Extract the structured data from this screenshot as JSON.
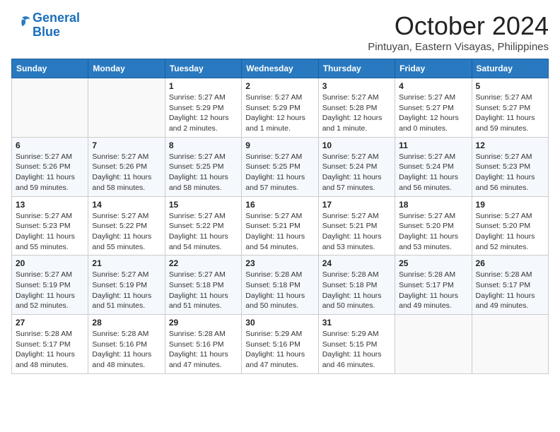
{
  "logo": {
    "line1": "General",
    "line2": "Blue"
  },
  "title": "October 2024",
  "location": "Pintuyan, Eastern Visayas, Philippines",
  "weekdays": [
    "Sunday",
    "Monday",
    "Tuesday",
    "Wednesday",
    "Thursday",
    "Friday",
    "Saturday"
  ],
  "weeks": [
    [
      {
        "day": "",
        "info": ""
      },
      {
        "day": "",
        "info": ""
      },
      {
        "day": "1",
        "info": "Sunrise: 5:27 AM\nSunset: 5:29 PM\nDaylight: 12 hours and 2 minutes."
      },
      {
        "day": "2",
        "info": "Sunrise: 5:27 AM\nSunset: 5:29 PM\nDaylight: 12 hours and 1 minute."
      },
      {
        "day": "3",
        "info": "Sunrise: 5:27 AM\nSunset: 5:28 PM\nDaylight: 12 hours and 1 minute."
      },
      {
        "day": "4",
        "info": "Sunrise: 5:27 AM\nSunset: 5:27 PM\nDaylight: 12 hours and 0 minutes."
      },
      {
        "day": "5",
        "info": "Sunrise: 5:27 AM\nSunset: 5:27 PM\nDaylight: 11 hours and 59 minutes."
      }
    ],
    [
      {
        "day": "6",
        "info": "Sunrise: 5:27 AM\nSunset: 5:26 PM\nDaylight: 11 hours and 59 minutes."
      },
      {
        "day": "7",
        "info": "Sunrise: 5:27 AM\nSunset: 5:26 PM\nDaylight: 11 hours and 58 minutes."
      },
      {
        "day": "8",
        "info": "Sunrise: 5:27 AM\nSunset: 5:25 PM\nDaylight: 11 hours and 58 minutes."
      },
      {
        "day": "9",
        "info": "Sunrise: 5:27 AM\nSunset: 5:25 PM\nDaylight: 11 hours and 57 minutes."
      },
      {
        "day": "10",
        "info": "Sunrise: 5:27 AM\nSunset: 5:24 PM\nDaylight: 11 hours and 57 minutes."
      },
      {
        "day": "11",
        "info": "Sunrise: 5:27 AM\nSunset: 5:24 PM\nDaylight: 11 hours and 56 minutes."
      },
      {
        "day": "12",
        "info": "Sunrise: 5:27 AM\nSunset: 5:23 PM\nDaylight: 11 hours and 56 minutes."
      }
    ],
    [
      {
        "day": "13",
        "info": "Sunrise: 5:27 AM\nSunset: 5:23 PM\nDaylight: 11 hours and 55 minutes."
      },
      {
        "day": "14",
        "info": "Sunrise: 5:27 AM\nSunset: 5:22 PM\nDaylight: 11 hours and 55 minutes."
      },
      {
        "day": "15",
        "info": "Sunrise: 5:27 AM\nSunset: 5:22 PM\nDaylight: 11 hours and 54 minutes."
      },
      {
        "day": "16",
        "info": "Sunrise: 5:27 AM\nSunset: 5:21 PM\nDaylight: 11 hours and 54 minutes."
      },
      {
        "day": "17",
        "info": "Sunrise: 5:27 AM\nSunset: 5:21 PM\nDaylight: 11 hours and 53 minutes."
      },
      {
        "day": "18",
        "info": "Sunrise: 5:27 AM\nSunset: 5:20 PM\nDaylight: 11 hours and 53 minutes."
      },
      {
        "day": "19",
        "info": "Sunrise: 5:27 AM\nSunset: 5:20 PM\nDaylight: 11 hours and 52 minutes."
      }
    ],
    [
      {
        "day": "20",
        "info": "Sunrise: 5:27 AM\nSunset: 5:19 PM\nDaylight: 11 hours and 52 minutes."
      },
      {
        "day": "21",
        "info": "Sunrise: 5:27 AM\nSunset: 5:19 PM\nDaylight: 11 hours and 51 minutes."
      },
      {
        "day": "22",
        "info": "Sunrise: 5:27 AM\nSunset: 5:18 PM\nDaylight: 11 hours and 51 minutes."
      },
      {
        "day": "23",
        "info": "Sunrise: 5:28 AM\nSunset: 5:18 PM\nDaylight: 11 hours and 50 minutes."
      },
      {
        "day": "24",
        "info": "Sunrise: 5:28 AM\nSunset: 5:18 PM\nDaylight: 11 hours and 50 minutes."
      },
      {
        "day": "25",
        "info": "Sunrise: 5:28 AM\nSunset: 5:17 PM\nDaylight: 11 hours and 49 minutes."
      },
      {
        "day": "26",
        "info": "Sunrise: 5:28 AM\nSunset: 5:17 PM\nDaylight: 11 hours and 49 minutes."
      }
    ],
    [
      {
        "day": "27",
        "info": "Sunrise: 5:28 AM\nSunset: 5:17 PM\nDaylight: 11 hours and 48 minutes."
      },
      {
        "day": "28",
        "info": "Sunrise: 5:28 AM\nSunset: 5:16 PM\nDaylight: 11 hours and 48 minutes."
      },
      {
        "day": "29",
        "info": "Sunrise: 5:28 AM\nSunset: 5:16 PM\nDaylight: 11 hours and 47 minutes."
      },
      {
        "day": "30",
        "info": "Sunrise: 5:29 AM\nSunset: 5:16 PM\nDaylight: 11 hours and 47 minutes."
      },
      {
        "day": "31",
        "info": "Sunrise: 5:29 AM\nSunset: 5:15 PM\nDaylight: 11 hours and 46 minutes."
      },
      {
        "day": "",
        "info": ""
      },
      {
        "day": "",
        "info": ""
      }
    ]
  ]
}
